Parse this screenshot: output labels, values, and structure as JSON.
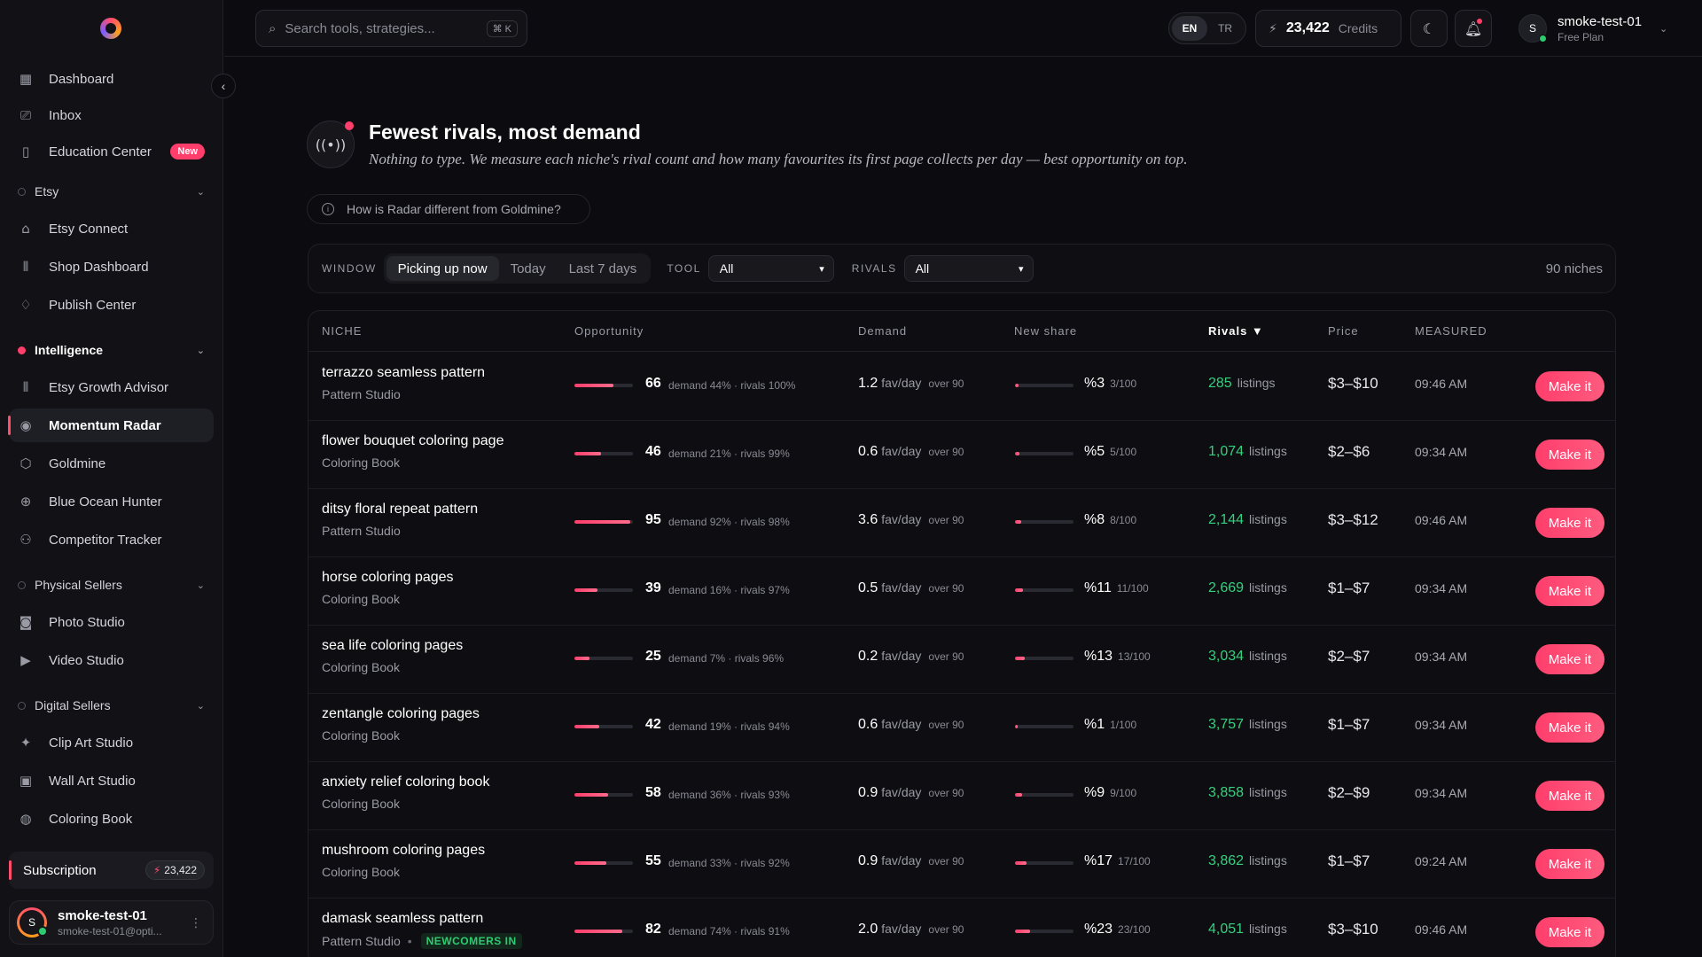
{
  "sidebar": {
    "items": [
      {
        "label": "Dashboard",
        "icon": "dashboard-icon",
        "glyph": "▦"
      },
      {
        "label": "Inbox",
        "icon": "inbox-icon",
        "glyph": "⎚"
      },
      {
        "label": "Education Center",
        "icon": "book-icon",
        "glyph": "▯",
        "badge": "New"
      }
    ],
    "sections": [
      {
        "label": "Etsy",
        "active": false,
        "items": [
          {
            "label": "Etsy Connect",
            "icon": "store-icon",
            "glyph": "⌂"
          },
          {
            "label": "Shop Dashboard",
            "icon": "bar-chart-icon",
            "glyph": "⫴"
          },
          {
            "label": "Publish Center",
            "icon": "bell-icon",
            "glyph": "♢"
          }
        ]
      },
      {
        "label": "Intelligence",
        "active": true,
        "items": [
          {
            "label": "Etsy Growth Advisor",
            "icon": "bar-chart-icon",
            "glyph": "⫴"
          },
          {
            "label": "Momentum Radar",
            "icon": "radar-icon",
            "glyph": "◉",
            "active": true
          },
          {
            "label": "Goldmine",
            "icon": "cube-icon",
            "glyph": "⬡"
          },
          {
            "label": "Blue Ocean Hunter",
            "icon": "globe-icon",
            "glyph": "⊕"
          },
          {
            "label": "Competitor Tracker",
            "icon": "users-icon",
            "glyph": "⚇"
          }
        ]
      },
      {
        "label": "Physical Sellers",
        "active": false,
        "items": [
          {
            "label": "Photo Studio",
            "icon": "camera-icon",
            "glyph": "◙"
          },
          {
            "label": "Video Studio",
            "icon": "video-icon",
            "glyph": "▶"
          }
        ]
      },
      {
        "label": "Digital Sellers",
        "active": false,
        "items": [
          {
            "label": "Clip Art Studio",
            "icon": "sparkles-icon",
            "glyph": "✦"
          },
          {
            "label": "Wall Art Studio",
            "icon": "frame-icon",
            "glyph": "▣"
          },
          {
            "label": "Coloring Book",
            "icon": "palette-icon",
            "glyph": "◍"
          }
        ]
      }
    ],
    "subscription": {
      "label": "Subscription",
      "credits": "23,422"
    },
    "user": {
      "initial": "S",
      "name": "smoke-test-01",
      "email": "smoke-test-01@opti..."
    }
  },
  "topbar": {
    "search_placeholder": "Search tools, strategies...",
    "shortcut": "⌘ K",
    "lang": [
      "EN",
      "TR"
    ],
    "lang_active": "EN",
    "credits_value": "23,422",
    "credits_label": "Credits",
    "user_initial": "S",
    "user_name": "smoke-test-01",
    "user_plan": "Free Plan"
  },
  "hero": {
    "title": "Fewest rivals, most demand",
    "subtitle": "Nothing to type. We measure each niche's rival count and how many favourites its first page collects per day — best opportunity on top.",
    "faq": "How is Radar different from Goldmine?"
  },
  "filters": {
    "window_label": "WINDOW",
    "window_options": [
      "Picking up now",
      "Today",
      "Last 7 days"
    ],
    "window_active": "Picking up now",
    "tool_label": "TOOL",
    "tool_value": "All",
    "rivals_label": "RIVALS",
    "rivals_value": "All",
    "count": "90 niches"
  },
  "table": {
    "headers": {
      "niche": "NICHE",
      "opportunity": "Opportunity",
      "demand": "Demand",
      "new_share": "New share",
      "rivals": "Rivals ▼",
      "price": "Price",
      "measured": "MEASURED"
    },
    "action_label": "Make it",
    "demand_unit": "fav/day",
    "rivals_unit": "listings",
    "rows": [
      {
        "niche": "terrazzo seamless pattern",
        "tool": "Pattern Studio",
        "opportunity": 66,
        "opp_meta": "demand 44% · rivals 100%",
        "demand": "1.2",
        "demand_over": "over 90",
        "new_share": "%3",
        "new_share_meta": "3/100",
        "new_share_frac": 0.03,
        "rivals": "285",
        "price": "$3–$10",
        "measured": "09:46 AM"
      },
      {
        "niche": "flower bouquet coloring page",
        "tool": "Coloring Book",
        "opportunity": 46,
        "opp_meta": "demand 21% · rivals 99%",
        "demand": "0.6",
        "demand_over": "over 90",
        "new_share": "%5",
        "new_share_meta": "5/100",
        "new_share_frac": 0.05,
        "rivals": "1,074",
        "price": "$2–$6",
        "measured": "09:34 AM"
      },
      {
        "niche": "ditsy floral repeat pattern",
        "tool": "Pattern Studio",
        "opportunity": 95,
        "opp_meta": "demand 92% · rivals 98%",
        "demand": "3.6",
        "demand_over": "over 90",
        "new_share": "%8",
        "new_share_meta": "8/100",
        "new_share_frac": 0.08,
        "rivals": "2,144",
        "price": "$3–$12",
        "measured": "09:46 AM"
      },
      {
        "niche": "horse coloring pages",
        "tool": "Coloring Book",
        "opportunity": 39,
        "opp_meta": "demand 16% · rivals 97%",
        "demand": "0.5",
        "demand_over": "over 90",
        "new_share": "%11",
        "new_share_meta": "11/100",
        "new_share_frac": 0.11,
        "rivals": "2,669",
        "price": "$1–$7",
        "measured": "09:34 AM"
      },
      {
        "niche": "sea life coloring pages",
        "tool": "Coloring Book",
        "opportunity": 25,
        "opp_meta": "demand 7% · rivals 96%",
        "demand": "0.2",
        "demand_over": "over 90",
        "new_share": "%13",
        "new_share_meta": "13/100",
        "new_share_frac": 0.13,
        "rivals": "3,034",
        "price": "$2–$7",
        "measured": "09:34 AM"
      },
      {
        "niche": "zentangle coloring pages",
        "tool": "Coloring Book",
        "opportunity": 42,
        "opp_meta": "demand 19% · rivals 94%",
        "demand": "0.6",
        "demand_over": "over 90",
        "new_share": "%1",
        "new_share_meta": "1/100",
        "new_share_frac": 0.01,
        "rivals": "3,757",
        "price": "$1–$7",
        "measured": "09:34 AM"
      },
      {
        "niche": "anxiety relief coloring book",
        "tool": "Coloring Book",
        "opportunity": 58,
        "opp_meta": "demand 36% · rivals 93%",
        "demand": "0.9",
        "demand_over": "over 90",
        "new_share": "%9",
        "new_share_meta": "9/100",
        "new_share_frac": 0.09,
        "rivals": "3,858",
        "price": "$2–$9",
        "measured": "09:34 AM"
      },
      {
        "niche": "mushroom coloring pages",
        "tool": "Coloring Book",
        "opportunity": 55,
        "opp_meta": "demand 33% · rivals 92%",
        "demand": "0.9",
        "demand_over": "over 90",
        "new_share": "%17",
        "new_share_meta": "17/100",
        "new_share_frac": 0.17,
        "rivals": "3,862",
        "price": "$1–$7",
        "measured": "09:24 AM"
      },
      {
        "niche": "damask seamless pattern",
        "tool": "Pattern Studio",
        "tag": "NEWCOMERS IN",
        "opportunity": 82,
        "opp_meta": "demand 74% · rivals 91%",
        "demand": "2.0",
        "demand_over": "over 90",
        "new_share": "%23",
        "new_share_meta": "23/100",
        "new_share_frac": 0.23,
        "rivals": "4,051",
        "price": "$3–$10",
        "measured": "09:46 AM"
      }
    ]
  }
}
